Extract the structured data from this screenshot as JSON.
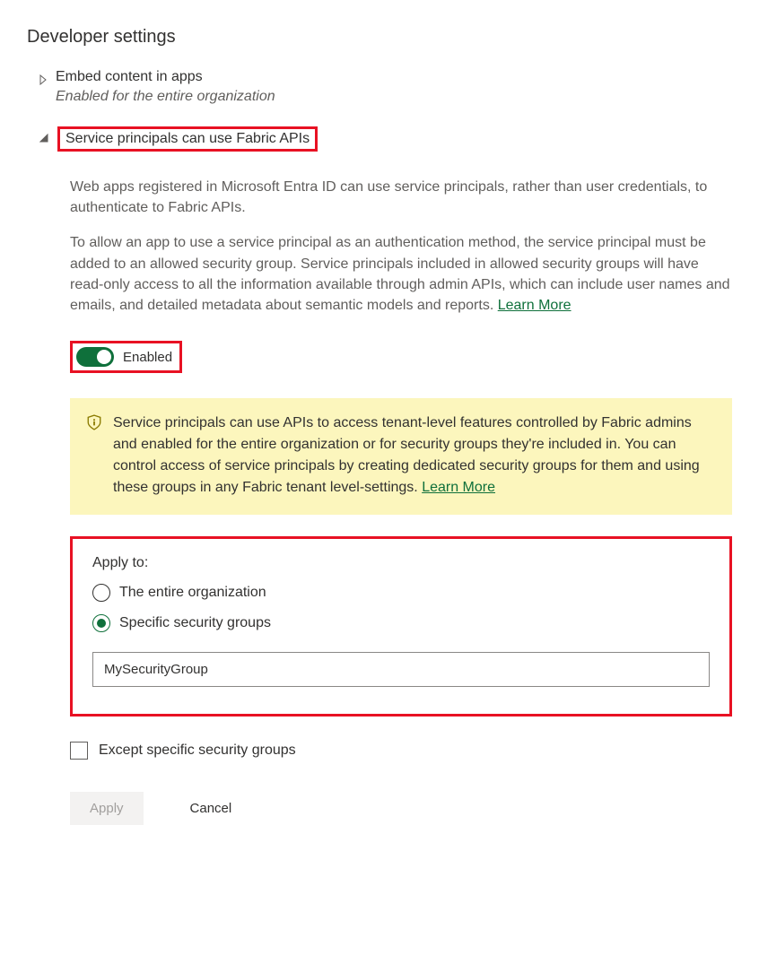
{
  "section_title": "Developer settings",
  "settings": {
    "embed": {
      "title": "Embed content in apps",
      "subtitle": "Enabled for the entire organization"
    },
    "service_principals": {
      "title": "Service principals can use Fabric APIs",
      "description1": "Web apps registered in Microsoft Entra ID can use service principals, rather than user credentials, to authenticate to Fabric APIs.",
      "description2": "To allow an app to use a service principal as an authentication method, the service principal must be added to an allowed security group. Service principals included in allowed security groups will have read-only access to all the information available through admin APIs, which can include user names and emails, and detailed metadata about semantic models and reports.  ",
      "learn_more": "Learn More",
      "toggle_label": "Enabled",
      "info_banner": "Service principals can use APIs to access tenant-level features controlled by Fabric admins and enabled for the entire organization or for security groups they're included in. You can control access of service principals by creating dedicated security groups for them and using these groups in any Fabric tenant level-settings.  ",
      "info_learn_more": "Learn More",
      "apply_to_label": "Apply to:",
      "radio_entire_org": "The entire organization",
      "radio_specific_groups": "Specific security groups",
      "security_group_value": "MySecurityGroup",
      "except_label": "Except specific security groups",
      "apply_button": "Apply",
      "cancel_button": "Cancel"
    }
  }
}
